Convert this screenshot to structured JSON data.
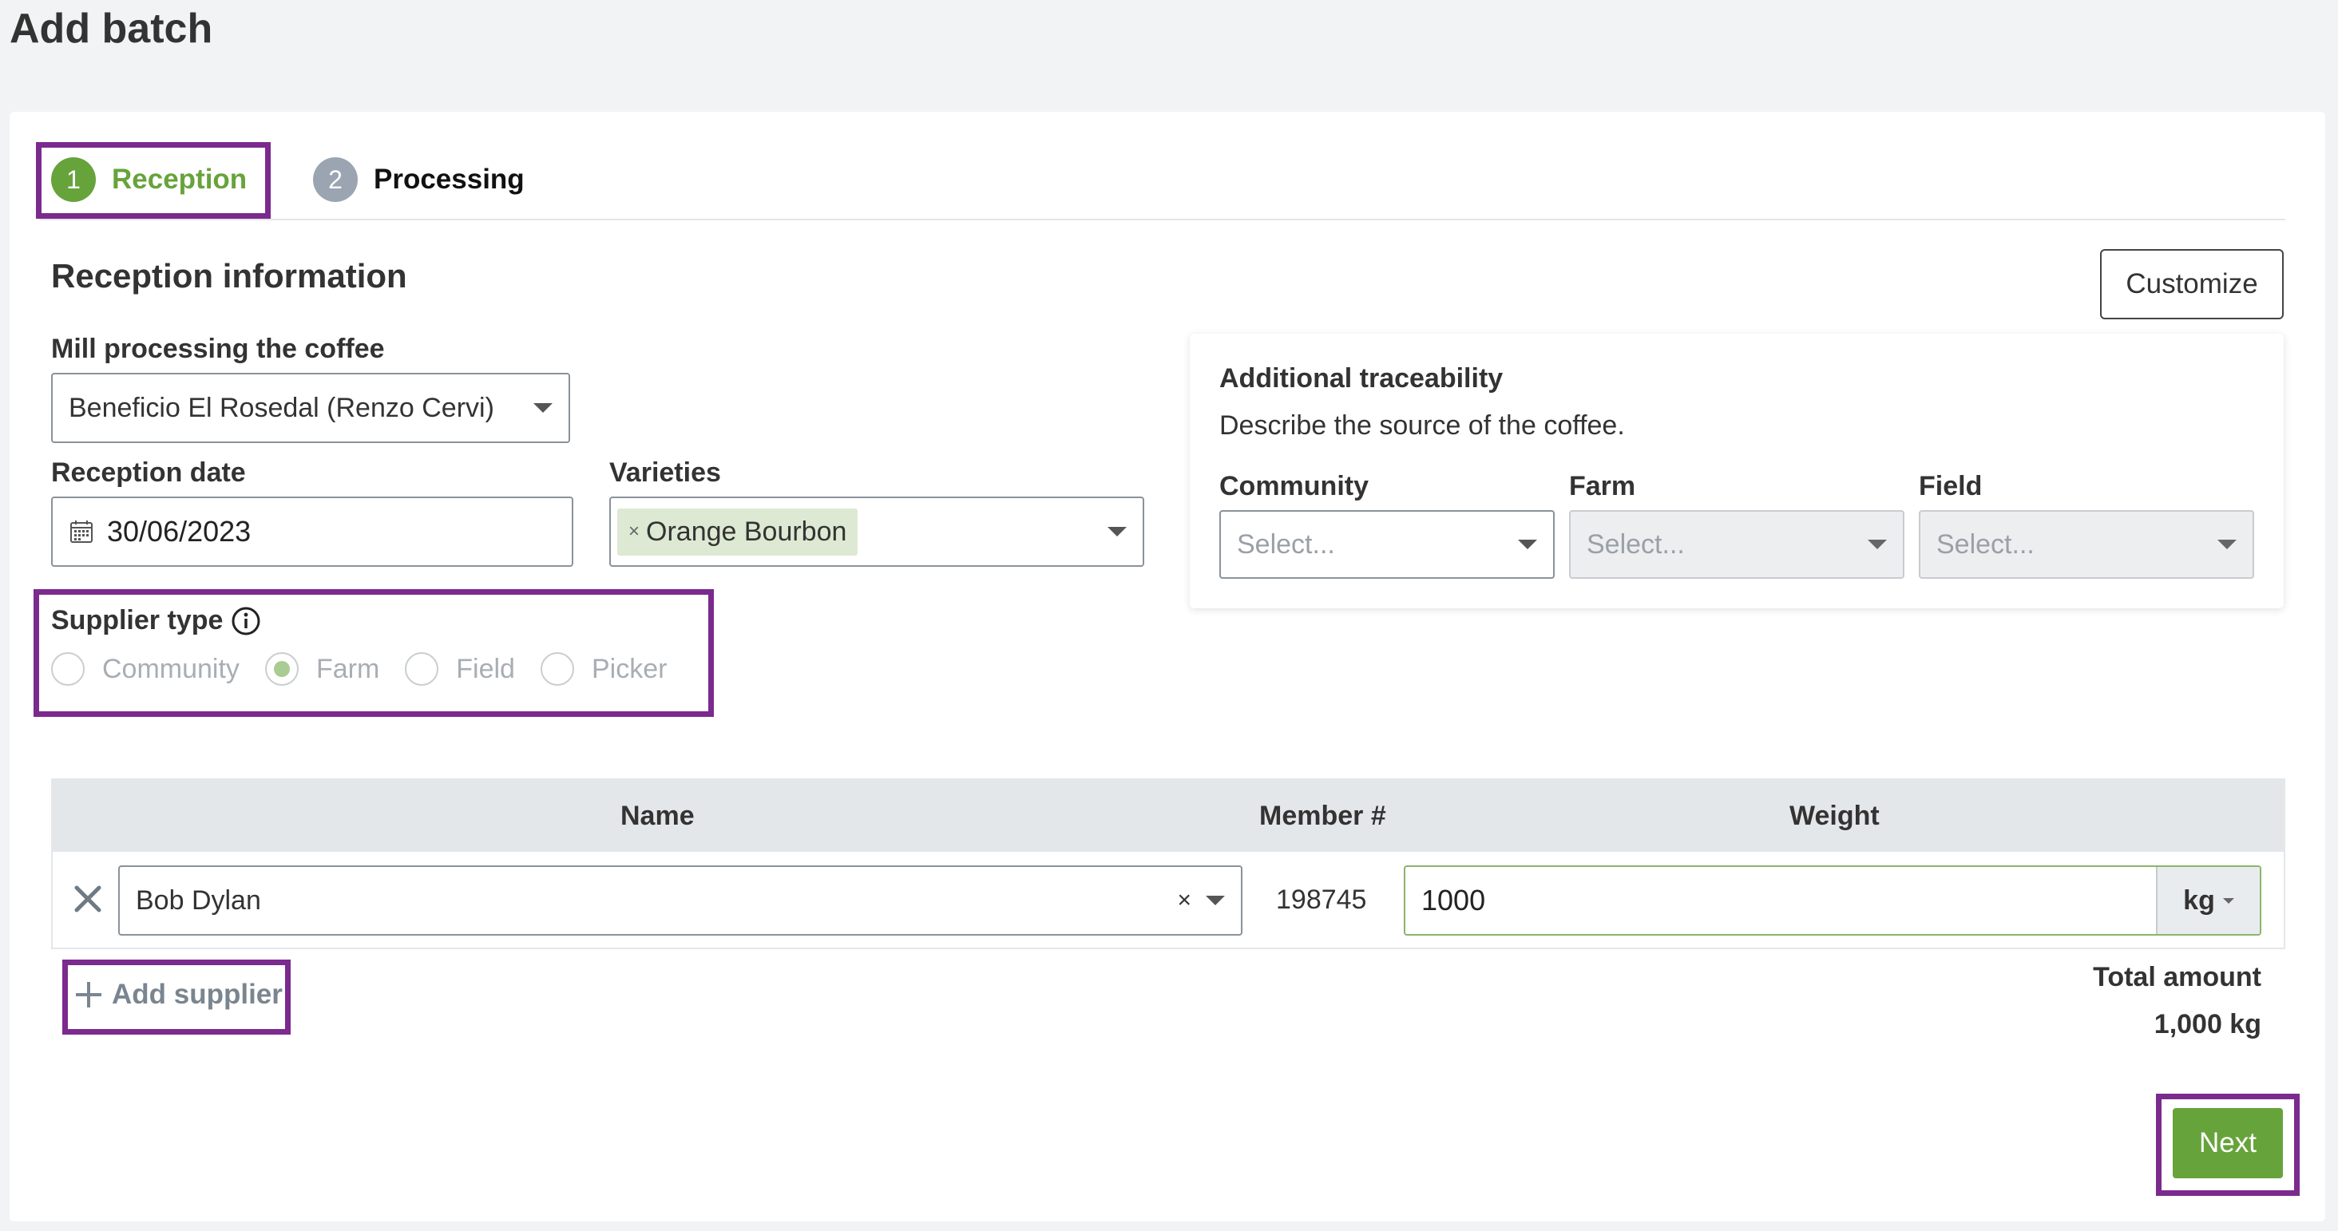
{
  "page": {
    "title": "Add batch"
  },
  "steps": [
    {
      "number": "1",
      "label": "Reception",
      "active": true,
      "color": "#67a33b"
    },
    {
      "number": "2",
      "label": "Processing",
      "active": false,
      "color": "#9aa5b1"
    }
  ],
  "reception": {
    "section_title": "Reception information",
    "customize_label": "Customize",
    "mill_label": "Mill processing the coffee",
    "mill_value": "Beneficio El Rosedal (Renzo Cervi)",
    "date_label": "Reception date",
    "date_value": "30/06/2023",
    "varieties_label": "Varieties",
    "varieties_selected": [
      "Orange Bourbon"
    ]
  },
  "traceability": {
    "title": "Additional traceability",
    "description": "Describe the source of the coffee.",
    "fields": [
      {
        "label": "Community",
        "placeholder": "Select...",
        "disabled": false
      },
      {
        "label": "Farm",
        "placeholder": "Select...",
        "disabled": true
      },
      {
        "label": "Field",
        "placeholder": "Select...",
        "disabled": true
      }
    ]
  },
  "supplier_type": {
    "label": "Supplier type",
    "options": [
      "Community",
      "Farm",
      "Field",
      "Picker"
    ],
    "selected": "Farm"
  },
  "suppliers_table": {
    "headers": {
      "name": "Name",
      "member": "Member #",
      "weight": "Weight"
    },
    "rows": [
      {
        "name": "Bob Dylan",
        "member": "198745",
        "weight": "1000",
        "unit": "kg"
      }
    ]
  },
  "add_supplier_label": "Add supplier",
  "total": {
    "label": "Total amount",
    "value": "1,000 kg"
  },
  "next_label": "Next",
  "colors": {
    "accent": "#67a33b",
    "highlight": "#7b2a8e"
  }
}
